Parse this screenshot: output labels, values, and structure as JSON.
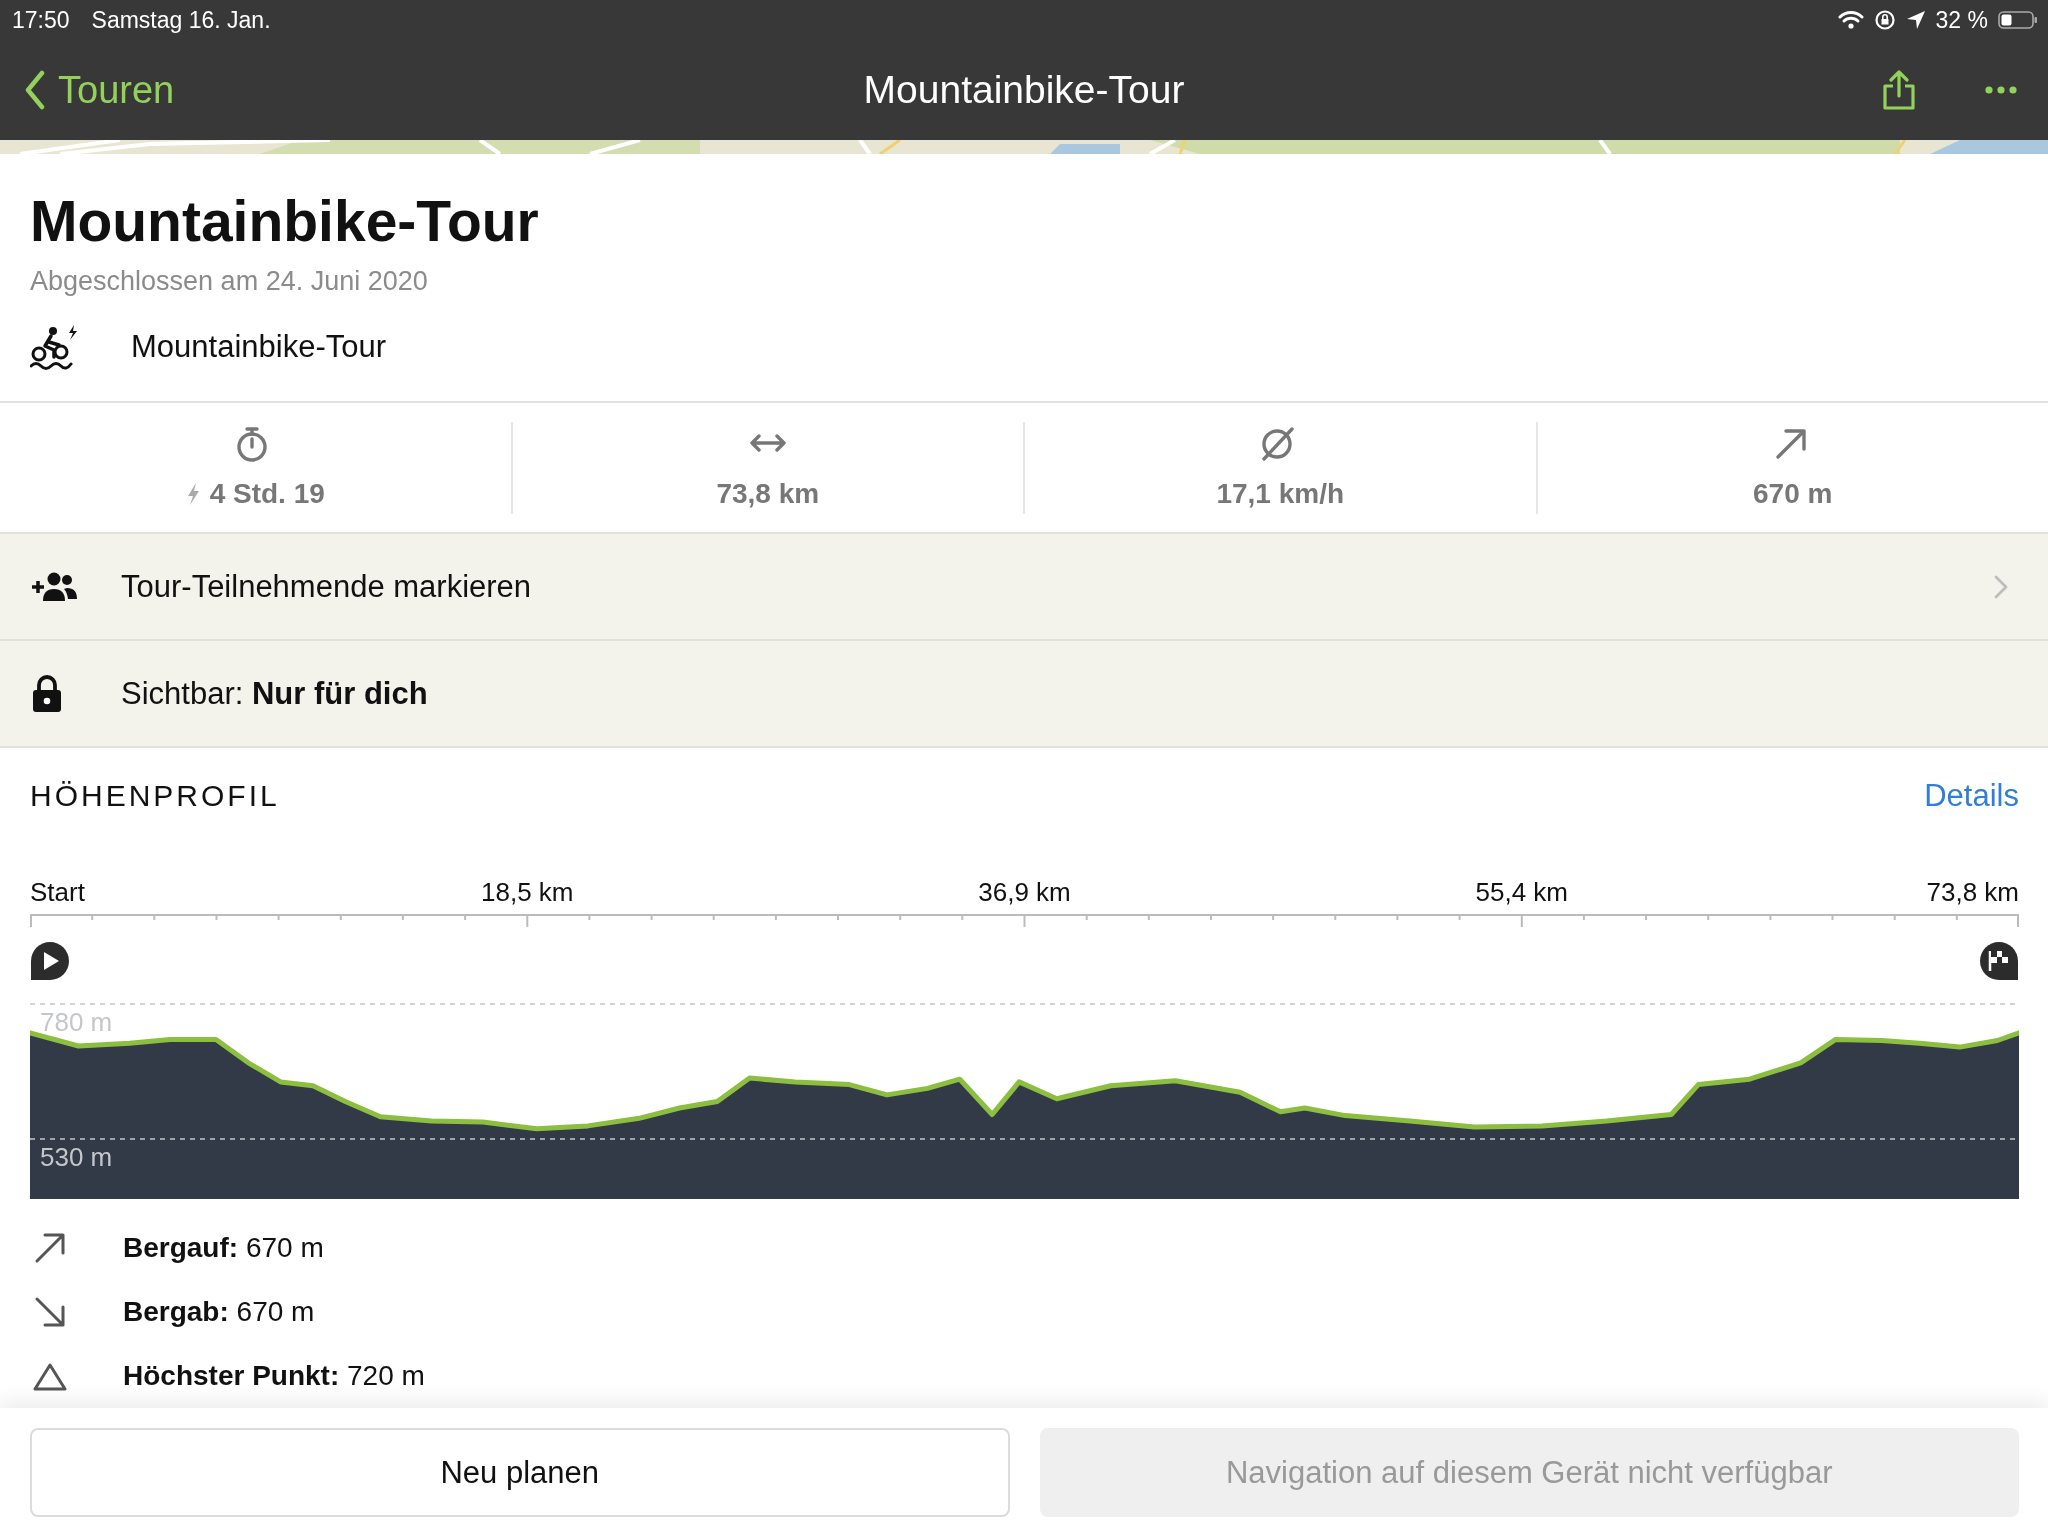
{
  "status_bar": {
    "time": "17:50",
    "date": "Samstag 16. Jan.",
    "battery": "32 %"
  },
  "nav_bar": {
    "back": "Touren",
    "title": "Mountainbike-Tour"
  },
  "tour": {
    "title": "Mountainbike-Tour",
    "subtitle": "Abgeschlossen am 24. Juni 2020",
    "sport": "Mountainbike-Tour"
  },
  "stats": [
    {
      "kind": "duration",
      "value": "4 Std. 19",
      "e_bike": true
    },
    {
      "kind": "distance",
      "value": "73,8 km",
      "e_bike": false
    },
    {
      "kind": "speed",
      "value": "17,1 km/h",
      "e_bike": false
    },
    {
      "kind": "ascent",
      "value": "670 m",
      "e_bike": false
    }
  ],
  "actions": [
    {
      "kind": "participants",
      "text": "Tour-Teilnehmende markieren",
      "chevron": true
    },
    {
      "kind": "visibility",
      "text": "Sichtbar: **Nur für dich**",
      "chevron": false
    }
  ],
  "elevation": {
    "heading": "HÖHENPROFIL",
    "link": "Details",
    "chart_data": {
      "type": "area",
      "xlim": [
        0,
        73.8
      ],
      "ylim": [
        530,
        780
      ],
      "xticks": [
        {
          "value": 0,
          "label": "Start"
        },
        {
          "value": 18.45,
          "label": "18,5 km"
        },
        {
          "value": 36.9,
          "label": "36,9 km"
        },
        {
          "value": 55.35,
          "label": "55,4 km"
        },
        {
          "value": 73.8,
          "label": "73,8 km"
        }
      ],
      "yticks": [
        {
          "value": 780,
          "label": "780 m"
        },
        {
          "value": 530,
          "label": "530 m"
        }
      ],
      "x": [
        0,
        1.8,
        3.7,
        5.2,
        6.9,
        8.1,
        9.3,
        10.5,
        11.7,
        13.0,
        14.9,
        16.8,
        18.8,
        20.7,
        22.6,
        24.1,
        25.5,
        26.7,
        28.4,
        30.4,
        31.8,
        33.3,
        34.5,
        35.7,
        36.7,
        38.1,
        40.1,
        42.5,
        44.9,
        46.4,
        47.3,
        48.8,
        51.2,
        53.6,
        56.1,
        58.5,
        60.9,
        61.9,
        63.8,
        65.7,
        67.0,
        68.7,
        70.1,
        71.6,
        73.0,
        73.8
      ],
      "series": [
        {
          "color": "#8cbf3f",
          "values": [
            725,
            701,
            706,
            713,
            713,
            670,
            635,
            628,
            599,
            571,
            563,
            561,
            549,
            554,
            568,
            587,
            599,
            642,
            635,
            630,
            611,
            623,
            640,
            575,
            635,
            604,
            628,
            637,
            616,
            580,
            587,
            573,
            563,
            552,
            554,
            563,
            575,
            630,
            640,
            670,
            713,
            711,
            706,
            699,
            711,
            725
          ]
        }
      ]
    },
    "summary": [
      {
        "kind": "ascent",
        "text": "**Bergauf:** 670 m"
      },
      {
        "kind": "descent",
        "text": "**Bergab:** 670 m"
      },
      {
        "kind": "highest",
        "text": "**Höchster Punkt:** 720 m"
      }
    ]
  },
  "buttons": [
    {
      "label": "Neu planen",
      "disabled": false
    },
    {
      "label": "Navigation auf diesem Gerät nicht verfügbar",
      "disabled": true
    }
  ]
}
